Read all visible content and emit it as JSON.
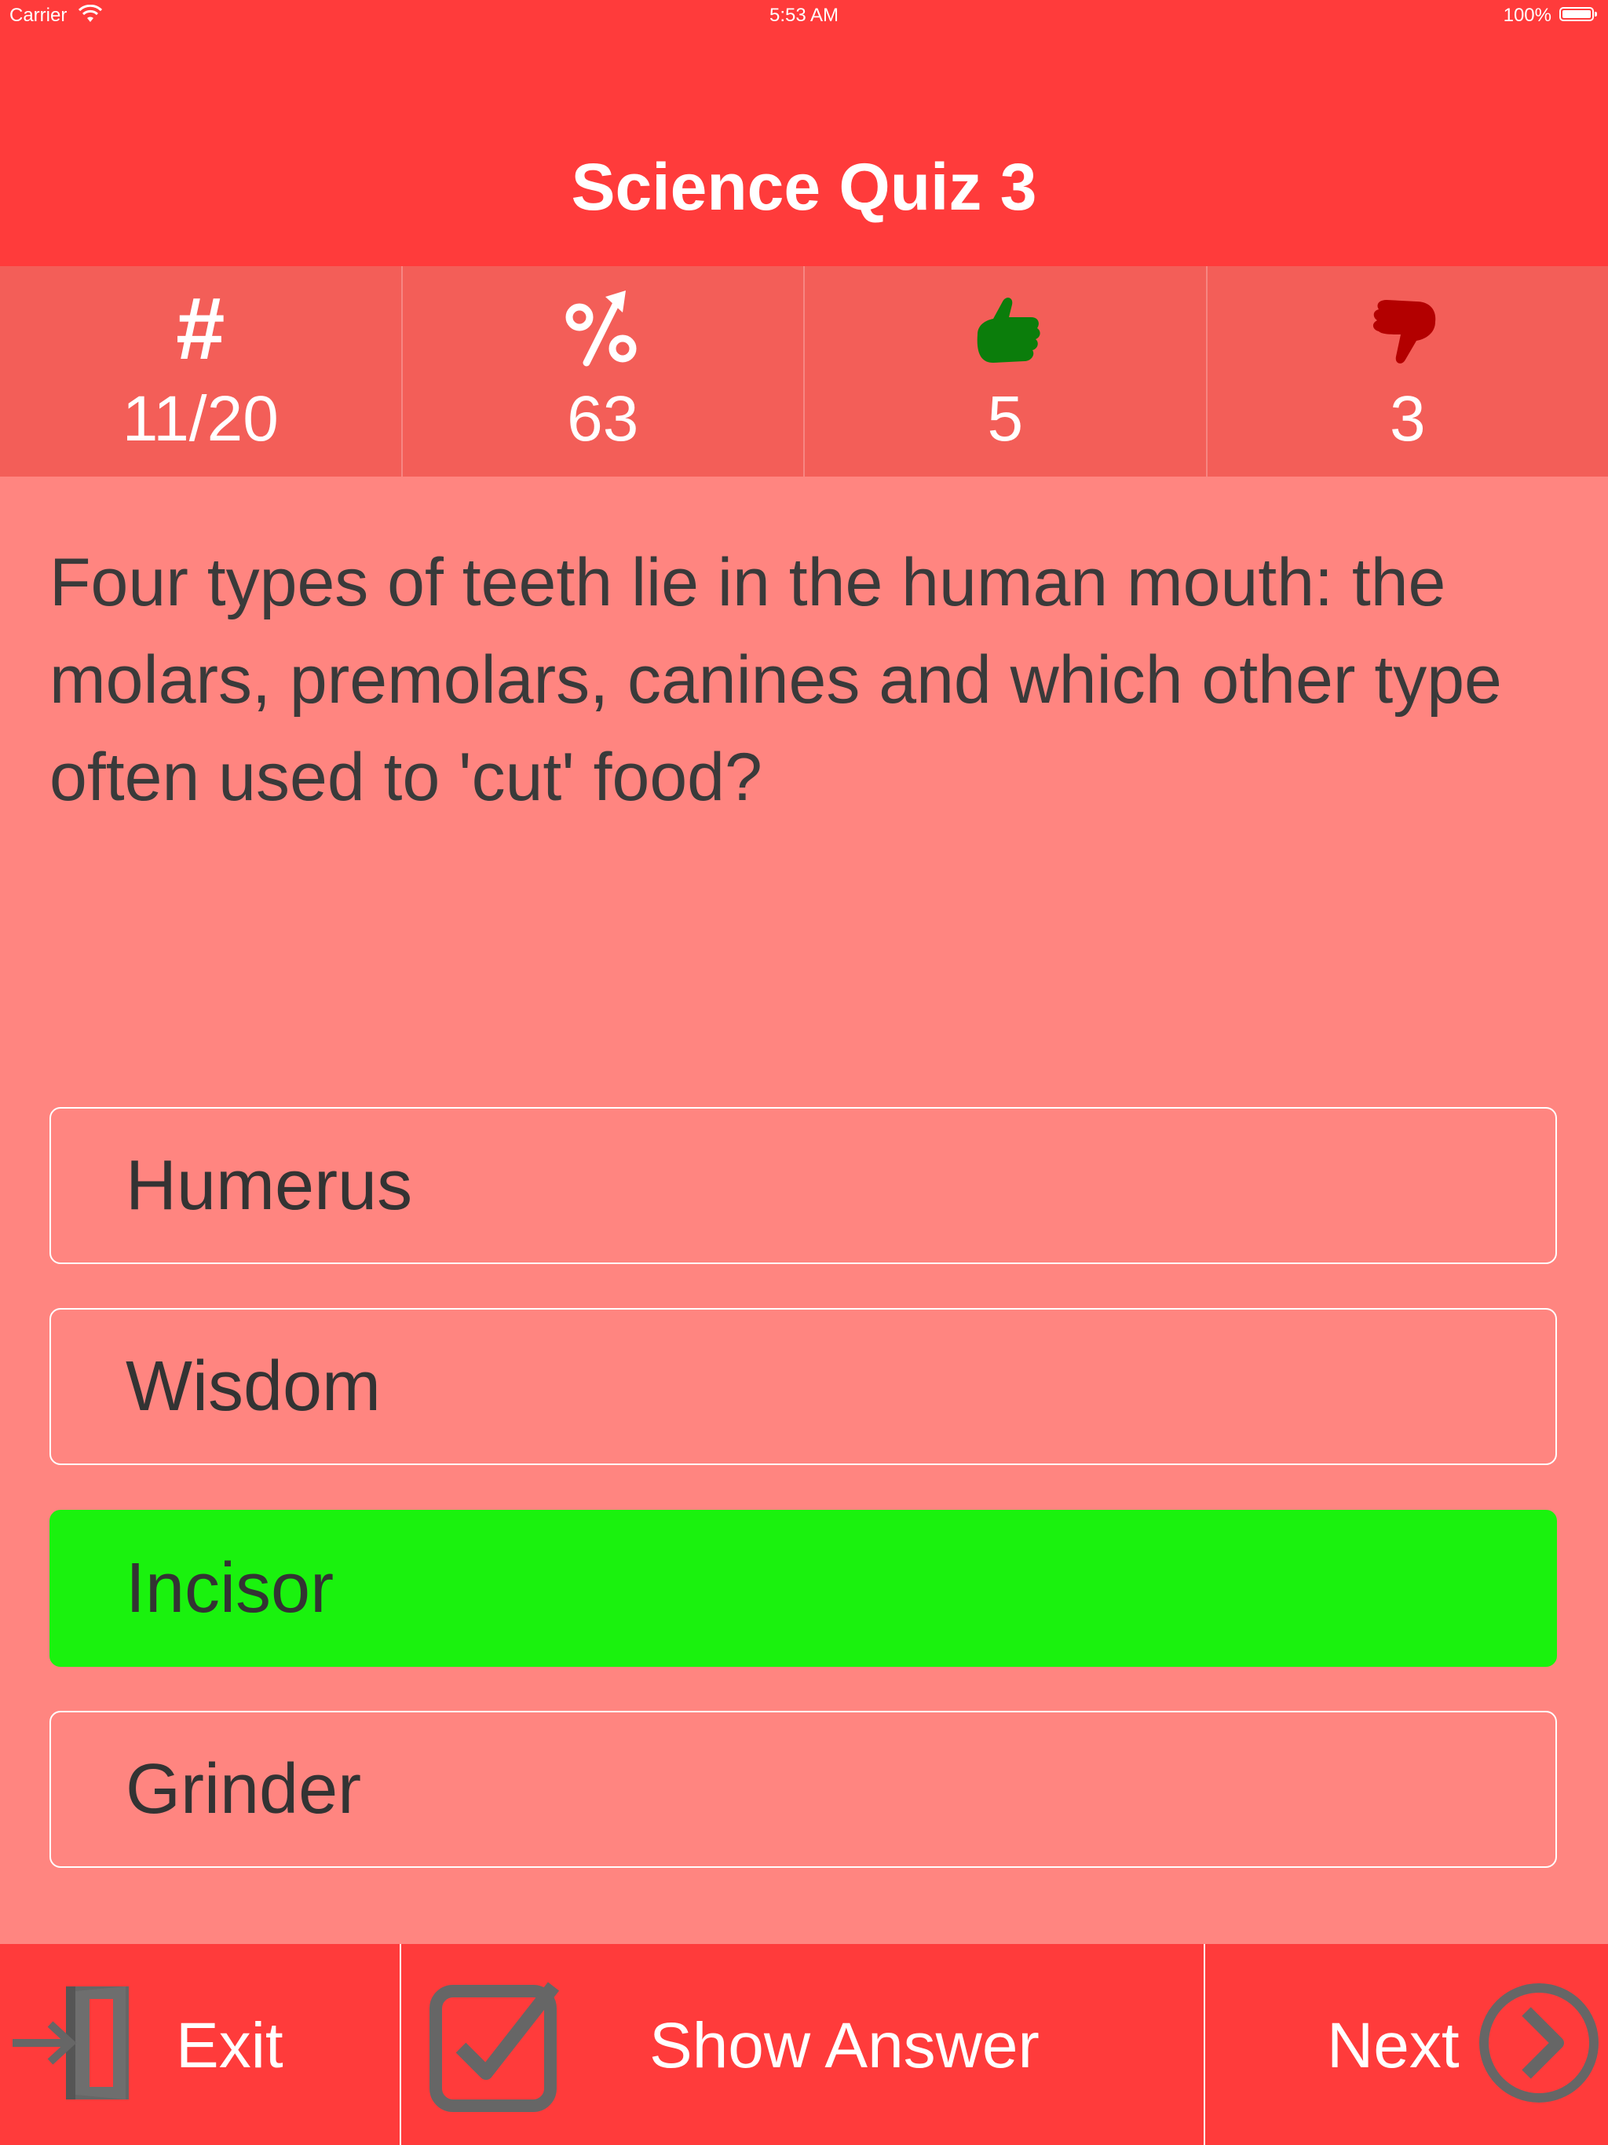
{
  "status_bar": {
    "carrier": "Carrier",
    "time": "5:53 AM",
    "battery": "100%"
  },
  "header": {
    "title": "Science Quiz 3"
  },
  "stats": [
    {
      "icon": "hash-icon",
      "symbol": "#",
      "value": "11/20"
    },
    {
      "icon": "percent-up-icon",
      "value": "63"
    },
    {
      "icon": "thumbs-up-icon",
      "value": "5"
    },
    {
      "icon": "thumbs-down-icon",
      "value": "3"
    }
  ],
  "question": {
    "text": "Four types of teeth lie in the human mouth: the molars, premolars, canines and which other type often used to 'cut' food?"
  },
  "answers": [
    {
      "label": "Humerus",
      "state": "default"
    },
    {
      "label": "Wisdom",
      "state": "default"
    },
    {
      "label": "Incisor",
      "state": "correct"
    },
    {
      "label": "Grinder",
      "state": "default"
    }
  ],
  "toolbar": {
    "exit_label": "Exit",
    "show_answer_label": "Show Answer",
    "next_label": "Next"
  },
  "colors": {
    "header": "#ff3b3b",
    "stats_bg": "#f35e58",
    "body_bg": "#ff8580",
    "correct": "#1af20e",
    "thumbs_up": "#0b7d0b",
    "thumbs_down": "#b30000",
    "icon_gray": "#666666"
  }
}
